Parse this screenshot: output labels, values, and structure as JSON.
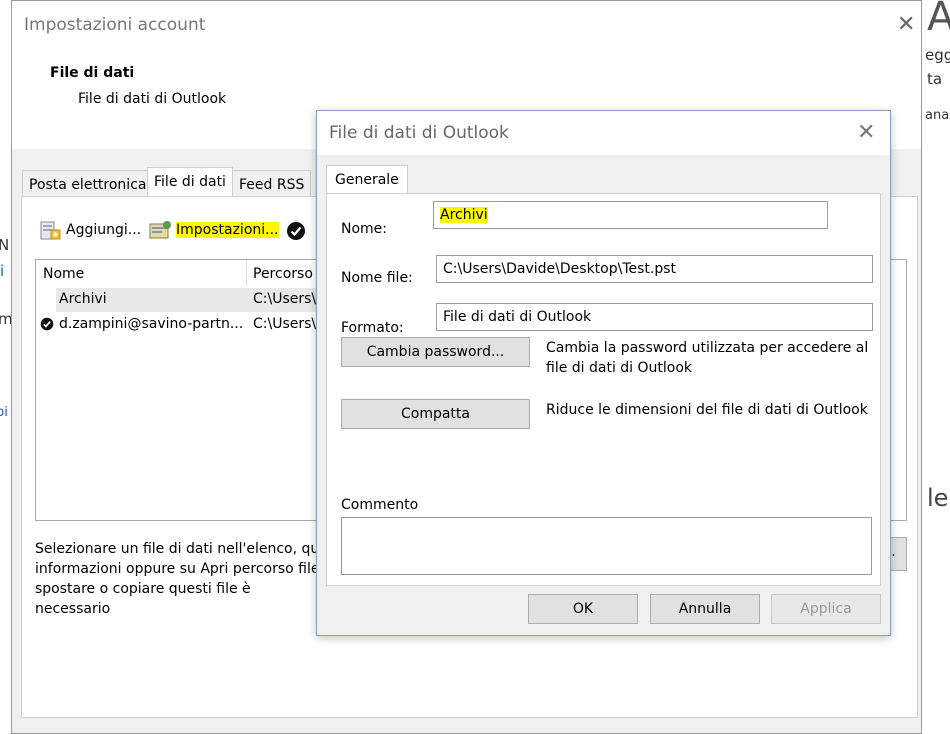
{
  "main_dialog": {
    "title": "Impostazioni account",
    "header_title": "File di dati",
    "header_subtitle": "File di dati di Outlook",
    "tabs": [
      "Posta elettronica",
      "File di dati",
      "Feed RSS"
    ],
    "toolbar": {
      "add_label": "Aggiungi...",
      "settings_label": "Impostazioni..."
    },
    "list": {
      "columns": [
        "Nome",
        "Percorso"
      ],
      "rows": [
        {
          "name": "Archivi",
          "path": "C:\\Users\\",
          "default": false
        },
        {
          "name": "d.zampini@savino-partn...",
          "path": "C:\\Users\\",
          "default": true
        }
      ]
    },
    "description_lines": [
      "Selezionare un file di dati nell'elenco, qui",
      "informazioni oppure su Apri percorso file",
      "spostare o copiare questi file è necessario"
    ]
  },
  "background": {
    "left_fragments": [
      "N",
      "i",
      "m",
      "bi"
    ],
    "right_fragments": [
      "A",
      "egg",
      "ta",
      "ana",
      "le"
    ]
  },
  "dialog": {
    "title": "File di dati di Outlook",
    "tab": "Generale",
    "name_label": "Nome:",
    "name_value": "Archivi",
    "filename_label": "Nome file:",
    "filename_value": "C:\\Users\\Davide\\Desktop\\Test.pst",
    "format_label": "Formato:",
    "format_value": "File di dati di Outlook",
    "change_password_button": "Cambia password...",
    "change_password_desc": [
      "Cambia la password utilizzata per accedere al",
      "file di dati di Outlook"
    ],
    "compact_button": "Compatta",
    "compact_desc": "Riduce le dimensioni del file di dati di Outlook",
    "comment_label": "Commento",
    "comment_value": "",
    "ok_button": "OK",
    "cancel_button": "Annulla",
    "apply_button": "Applica"
  },
  "colors": {
    "highlight": "#fff700",
    "dialog_bg": "#f0f0f0",
    "button_bg": "#e1e1e1"
  }
}
